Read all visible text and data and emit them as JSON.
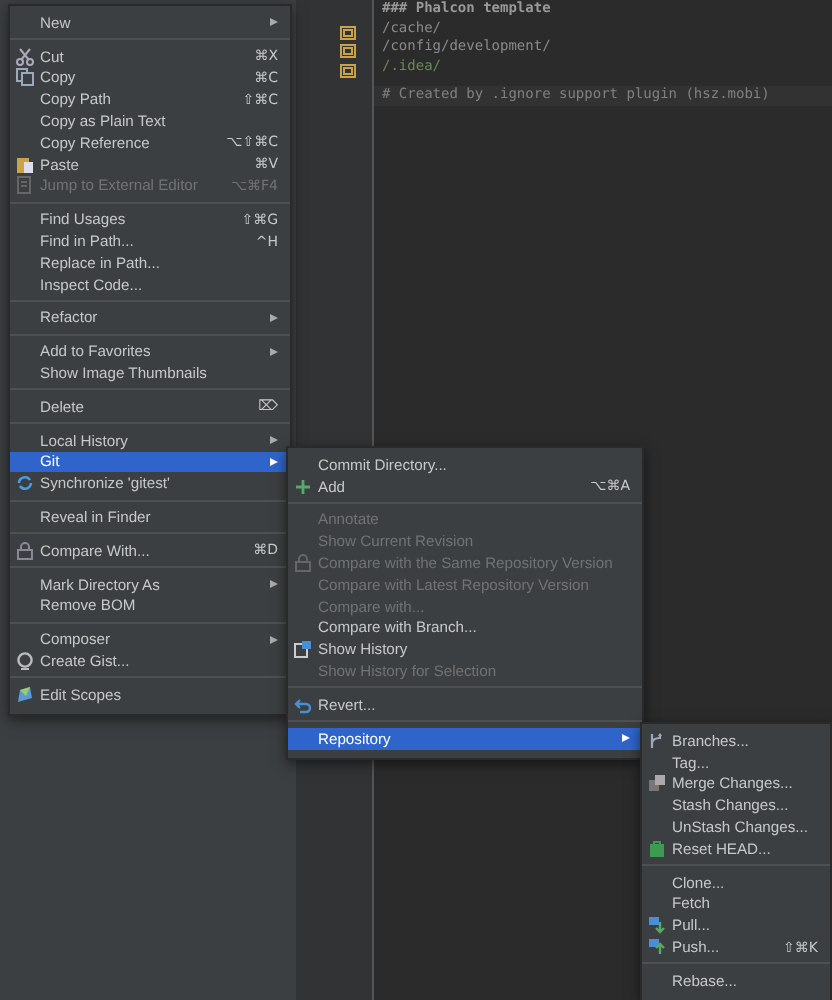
{
  "editor": {
    "lines": [
      {
        "text": "### Phalcon template",
        "kind": "heading"
      },
      {
        "text": "/cache/",
        "kind": "path"
      },
      {
        "text": "/config/development/",
        "kind": "path"
      },
      {
        "text": "/.idea/",
        "kind": "ignored"
      },
      {
        "text": "# Created by .ignore support plugin (hsz.mobi)",
        "kind": "comment"
      }
    ]
  },
  "menus": [
    {
      "items": [
        {
          "kind": "item",
          "label": "New",
          "submenu": true,
          "disabled": false,
          "selected": false
        },
        {
          "kind": "separator"
        },
        {
          "kind": "item",
          "label": "Cut",
          "shortcut": "⌘X",
          "disabled": false,
          "selected": false
        },
        {
          "kind": "item",
          "label": "Copy",
          "shortcut": "⌘C",
          "disabled": false,
          "selected": false
        },
        {
          "kind": "item",
          "label": "Copy Path",
          "shortcut": "⇧⌘C",
          "disabled": false,
          "selected": false
        },
        {
          "kind": "item",
          "label": "Copy as Plain Text",
          "disabled": false,
          "selected": false
        },
        {
          "kind": "item",
          "label": "Copy Reference",
          "shortcut": "⌥⇧⌘C",
          "disabled": false,
          "selected": false
        },
        {
          "kind": "item",
          "label": "Paste",
          "shortcut": "⌘V",
          "disabled": false,
          "selected": false
        },
        {
          "kind": "item",
          "label": "Jump to External Editor",
          "shortcut": "⌥⌘F4",
          "disabled": true,
          "selected": false
        },
        {
          "kind": "separator"
        },
        {
          "kind": "item",
          "label": "Find Usages",
          "shortcut": "⇧⌘G",
          "disabled": false,
          "selected": false
        },
        {
          "kind": "item",
          "label": "Find in Path...",
          "shortcut": "^H",
          "disabled": false,
          "selected": false
        },
        {
          "kind": "item",
          "label": "Replace in Path...",
          "disabled": false,
          "selected": false
        },
        {
          "kind": "item",
          "label": "Inspect Code...",
          "disabled": false,
          "selected": false
        },
        {
          "kind": "separator"
        },
        {
          "kind": "item",
          "label": "Refactor",
          "submenu": true,
          "disabled": false,
          "selected": false
        },
        {
          "kind": "separator"
        },
        {
          "kind": "item",
          "label": "Add to Favorites",
          "submenu": true,
          "disabled": false,
          "selected": false
        },
        {
          "kind": "item",
          "label": "Show Image Thumbnails",
          "disabled": false,
          "selected": false
        },
        {
          "kind": "separator"
        },
        {
          "kind": "item",
          "label": "Delete",
          "shortcut": "⌦",
          "disabled": false,
          "selected": false
        },
        {
          "kind": "separator"
        },
        {
          "kind": "item",
          "label": "Local History",
          "submenu": true,
          "disabled": false,
          "selected": false
        },
        {
          "kind": "item",
          "label": "Git",
          "submenu": true,
          "disabled": false,
          "selected": true
        },
        {
          "kind": "item",
          "label": "Synchronize 'gitest'",
          "disabled": false,
          "selected": false
        },
        {
          "kind": "separator"
        },
        {
          "kind": "item",
          "label": "Reveal in Finder",
          "disabled": false,
          "selected": false
        },
        {
          "kind": "separator"
        },
        {
          "kind": "item",
          "label": "Compare With...",
          "shortcut": "⌘D",
          "disabled": false,
          "selected": false
        },
        {
          "kind": "separator"
        },
        {
          "kind": "item",
          "label": "Mark Directory As",
          "submenu": true,
          "disabled": false,
          "selected": false
        },
        {
          "kind": "item",
          "label": "Remove BOM",
          "disabled": false,
          "selected": false
        },
        {
          "kind": "separator"
        },
        {
          "kind": "item",
          "label": "Composer",
          "submenu": true,
          "disabled": false,
          "selected": false
        },
        {
          "kind": "item",
          "label": "Create Gist...",
          "disabled": false,
          "selected": false
        },
        {
          "kind": "separator"
        },
        {
          "kind": "item",
          "label": "Edit Scopes",
          "disabled": false,
          "selected": false
        }
      ]
    },
    {
      "items": [
        {
          "kind": "item",
          "label": "Commit Directory...",
          "disabled": false,
          "selected": false
        },
        {
          "kind": "item",
          "label": "Add",
          "shortcut": "⌥⌘A",
          "disabled": false,
          "selected": false
        },
        {
          "kind": "separator"
        },
        {
          "kind": "item",
          "label": "Annotate",
          "disabled": true,
          "selected": false
        },
        {
          "kind": "item",
          "label": "Show Current Revision",
          "disabled": true,
          "selected": false
        },
        {
          "kind": "item",
          "label": "Compare with the Same Repository Version",
          "disabled": true,
          "selected": false
        },
        {
          "kind": "item",
          "label": "Compare with Latest Repository Version",
          "disabled": true,
          "selected": false
        },
        {
          "kind": "item",
          "label": "Compare with...",
          "disabled": true,
          "selected": false
        },
        {
          "kind": "item",
          "label": "Compare with Branch...",
          "disabled": false,
          "selected": false
        },
        {
          "kind": "item",
          "label": "Show History",
          "disabled": false,
          "selected": false
        },
        {
          "kind": "item",
          "label": "Show History for Selection",
          "disabled": true,
          "selected": false
        },
        {
          "kind": "separator"
        },
        {
          "kind": "item",
          "label": "Revert...",
          "disabled": false,
          "selected": false
        },
        {
          "kind": "separator"
        },
        {
          "kind": "item",
          "label": "Repository",
          "submenu": true,
          "disabled": false,
          "selected": true
        }
      ]
    },
    {
      "items": [
        {
          "kind": "item",
          "label": "Branches...",
          "disabled": false,
          "selected": false
        },
        {
          "kind": "item",
          "label": "Tag...",
          "disabled": false,
          "selected": false
        },
        {
          "kind": "item",
          "label": "Merge Changes...",
          "disabled": false,
          "selected": false
        },
        {
          "kind": "item",
          "label": "Stash Changes...",
          "disabled": false,
          "selected": false
        },
        {
          "kind": "item",
          "label": "UnStash Changes...",
          "disabled": false,
          "selected": false
        },
        {
          "kind": "item",
          "label": "Reset HEAD...",
          "disabled": false,
          "selected": false
        },
        {
          "kind": "separator"
        },
        {
          "kind": "item",
          "label": "Clone...",
          "disabled": false,
          "selected": false
        },
        {
          "kind": "item",
          "label": "Fetch",
          "disabled": false,
          "selected": false
        },
        {
          "kind": "item",
          "label": "Pull...",
          "disabled": false,
          "selected": false
        },
        {
          "kind": "item",
          "label": "Push...",
          "shortcut": "⇧⌘K",
          "disabled": false,
          "selected": false
        },
        {
          "kind": "separator"
        },
        {
          "kind": "item",
          "label": "Rebase...",
          "disabled": false,
          "selected": false
        }
      ]
    }
  ]
}
